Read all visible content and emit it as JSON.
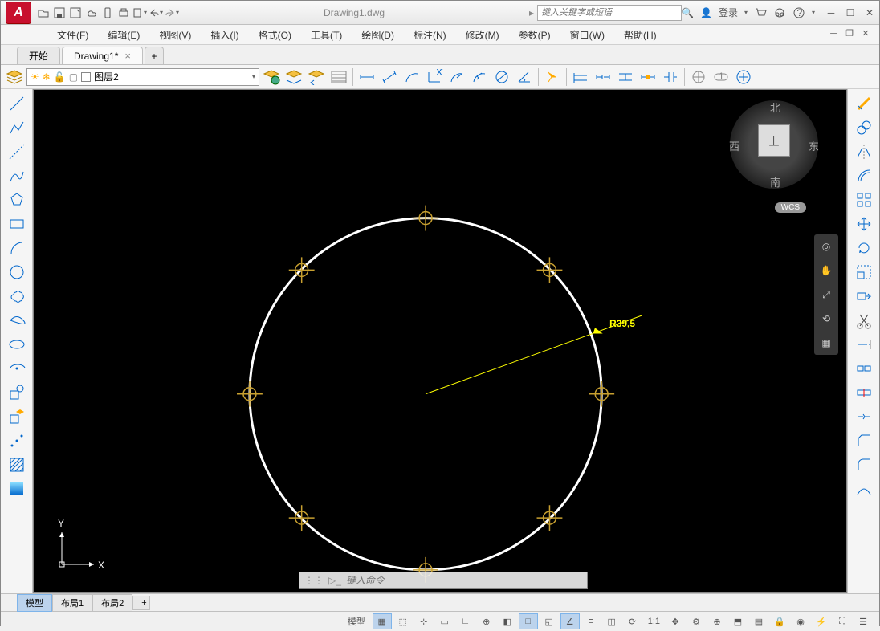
{
  "title": "Drawing1.dwg",
  "search_placeholder": "键入关键字或短语",
  "login_label": "登录",
  "menu": [
    "文件(F)",
    "编辑(E)",
    "视图(V)",
    "插入(I)",
    "格式(O)",
    "工具(T)",
    "绘图(D)",
    "标注(N)",
    "修改(M)",
    "参数(P)",
    "窗口(W)",
    "帮助(H)"
  ],
  "doc_tabs": [
    {
      "label": "开始",
      "active": false,
      "closable": false
    },
    {
      "label": "Drawing1*",
      "active": true,
      "closable": true
    }
  ],
  "layer_name": "图层2",
  "viewcube": {
    "top": "上",
    "n": "北",
    "s": "南",
    "e": "东",
    "w": "西"
  },
  "wcs": "WCS",
  "dimension_text": "R39,5",
  "cmd_placeholder": "键入命令",
  "layout_tabs": [
    "模型",
    "布局1",
    "布局2"
  ],
  "status_model": "模型",
  "status_scale": "1:1",
  "ucs": {
    "x": "X",
    "y": "Y"
  }
}
